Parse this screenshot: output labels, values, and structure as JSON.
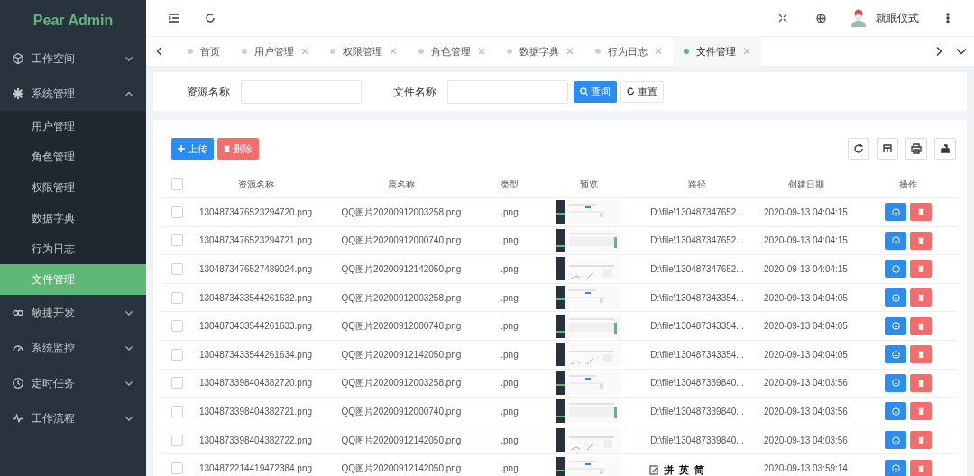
{
  "logo": "Pear Admin",
  "menu": [
    {
      "label": "工作空间",
      "expanded": false
    },
    {
      "label": "系统管理",
      "expanded": true,
      "children": [
        {
          "label": "用户管理",
          "selected": false
        },
        {
          "label": "角色管理",
          "selected": false
        },
        {
          "label": "权限管理",
          "selected": false
        },
        {
          "label": "数据字典",
          "selected": false
        },
        {
          "label": "行为日志",
          "selected": false
        },
        {
          "label": "文件管理",
          "selected": true
        }
      ]
    },
    {
      "label": "敏捷开发",
      "expanded": false
    },
    {
      "label": "系统监控",
      "expanded": false
    },
    {
      "label": "定时任务",
      "expanded": false
    },
    {
      "label": "工作流程",
      "expanded": false
    }
  ],
  "user": {
    "name": "就眠仪式"
  },
  "tabs": [
    {
      "label": "首页",
      "selected": false,
      "closable": false
    },
    {
      "label": "用户管理",
      "selected": false,
      "closable": true
    },
    {
      "label": "权限管理",
      "selected": false,
      "closable": true
    },
    {
      "label": "角色管理",
      "selected": false,
      "closable": true
    },
    {
      "label": "数据字典",
      "selected": false,
      "closable": true
    },
    {
      "label": "行为日志",
      "selected": false,
      "closable": true
    },
    {
      "label": "文件管理",
      "selected": true,
      "closable": true
    }
  ],
  "search": {
    "fields": [
      {
        "label": "资源名称"
      },
      {
        "label": "文件名称"
      }
    ],
    "query_button": "查询",
    "reset_button": "重置"
  },
  "toolbar": {
    "upload_button": "上传",
    "delete_button": "删除"
  },
  "table": {
    "all_checked": false,
    "columns": [
      "资源名称",
      "原名称",
      "类型",
      "预览",
      "路径",
      "创建日期",
      "操作"
    ],
    "rows": [
      {
        "checked": false,
        "name": "1304873476523294720.png",
        "original": "QQ图片20200912003258.png",
        "type": ".png",
        "path": "D:\\file\\130487347652...",
        "date": "2020-09-13 04:04:15"
      },
      {
        "checked": false,
        "name": "1304873476523294721.png",
        "original": "QQ图片20200912000740.png",
        "type": ".png",
        "path": "D:\\file\\130487347652...",
        "date": "2020-09-13 04:04:15"
      },
      {
        "checked": false,
        "name": "1304873476527489024.png",
        "original": "QQ图片20200912142050.png",
        "type": ".png",
        "path": "D:\\file\\130487347652...",
        "date": "2020-09-13 04:04:15"
      },
      {
        "checked": false,
        "name": "1304873433544261632.png",
        "original": "QQ图片20200912003258.png",
        "type": ".png",
        "path": "D:\\file\\130487343354...",
        "date": "2020-09-13 04:04:05"
      },
      {
        "checked": false,
        "name": "1304873433544261633.png",
        "original": "QQ图片20200912000740.png",
        "type": ".png",
        "path": "D:\\file\\130487343354...",
        "date": "2020-09-13 04:04:05"
      },
      {
        "checked": false,
        "name": "1304873433544261634.png",
        "original": "QQ图片20200912142050.png",
        "type": ".png",
        "path": "D:\\file\\130487343354...",
        "date": "2020-09-13 04:04:05"
      },
      {
        "checked": false,
        "name": "1304873398404382720.png",
        "original": "QQ图片20200912003258.png",
        "type": ".png",
        "path": "D:\\file\\130487339840...",
        "date": "2020-09-13 04:03:56"
      },
      {
        "checked": false,
        "name": "1304873398404382721.png",
        "original": "QQ图片20200912000740.png",
        "type": ".png",
        "path": "D:\\file\\130487339840...",
        "date": "2020-09-13 04:03:56"
      },
      {
        "checked": false,
        "name": "1304873398404382722.png",
        "original": "QQ图片20200912142050.png",
        "type": ".png",
        "path": "D:\\file\\130487339840...",
        "date": "2020-09-13 04:03:56"
      },
      {
        "checked": false,
        "name": "1304872214419472384.png",
        "original": "QQ图片20200912142050.png",
        "type": ".png",
        "date": "2020-09-13 03:59:14"
      }
    ]
  },
  "ime_toolbar": {
    "items": [
      "拼",
      "英",
      "简"
    ]
  }
}
